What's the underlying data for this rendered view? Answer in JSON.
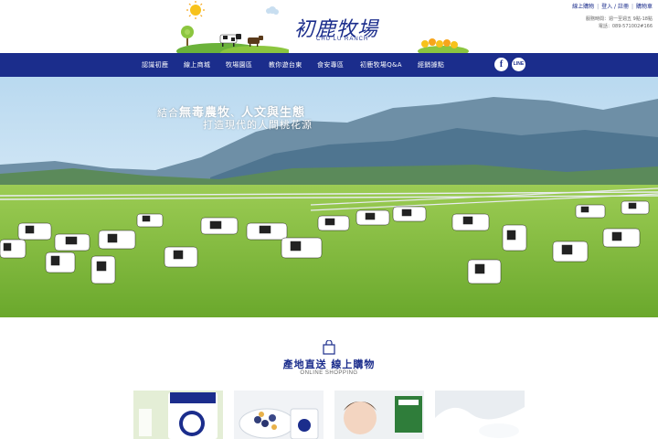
{
  "header": {
    "logo_title": "初鹿牧場",
    "logo_subtitle": "CHU LU RANCH",
    "top_links": [
      "線上購物",
      "登入 / 註冊",
      "購物車"
    ],
    "hours_line1": "服務時間：週一至週五 9點-18點",
    "hours_line2": "電話：089-571002#166"
  },
  "nav": {
    "items": [
      "認識初鹿",
      "線上商城",
      "牧場園區",
      "教你遊台東",
      "食安專區",
      "初鹿牧場Q&A",
      "經銷據點"
    ],
    "social": [
      "f",
      "LINE"
    ]
  },
  "hero": {
    "tagline1_pre": "結合",
    "tagline1_b1": "無毒農牧",
    "tagline1_mid": "、",
    "tagline1_b2": "人文與生態",
    "tagline2": "打造現代的人間桃花源"
  },
  "section": {
    "title": "產地直送  線上購物",
    "subtitle": "ONLINE SHOPPING"
  },
  "colors": {
    "brand": "#1b2d8c",
    "grass": "#7fbf3a",
    "sky": "#cfe6f7"
  },
  "icons": [
    "sun-icon",
    "tree-icon",
    "cow-icon",
    "shopping-bag-icon",
    "facebook-icon",
    "line-icon"
  ]
}
